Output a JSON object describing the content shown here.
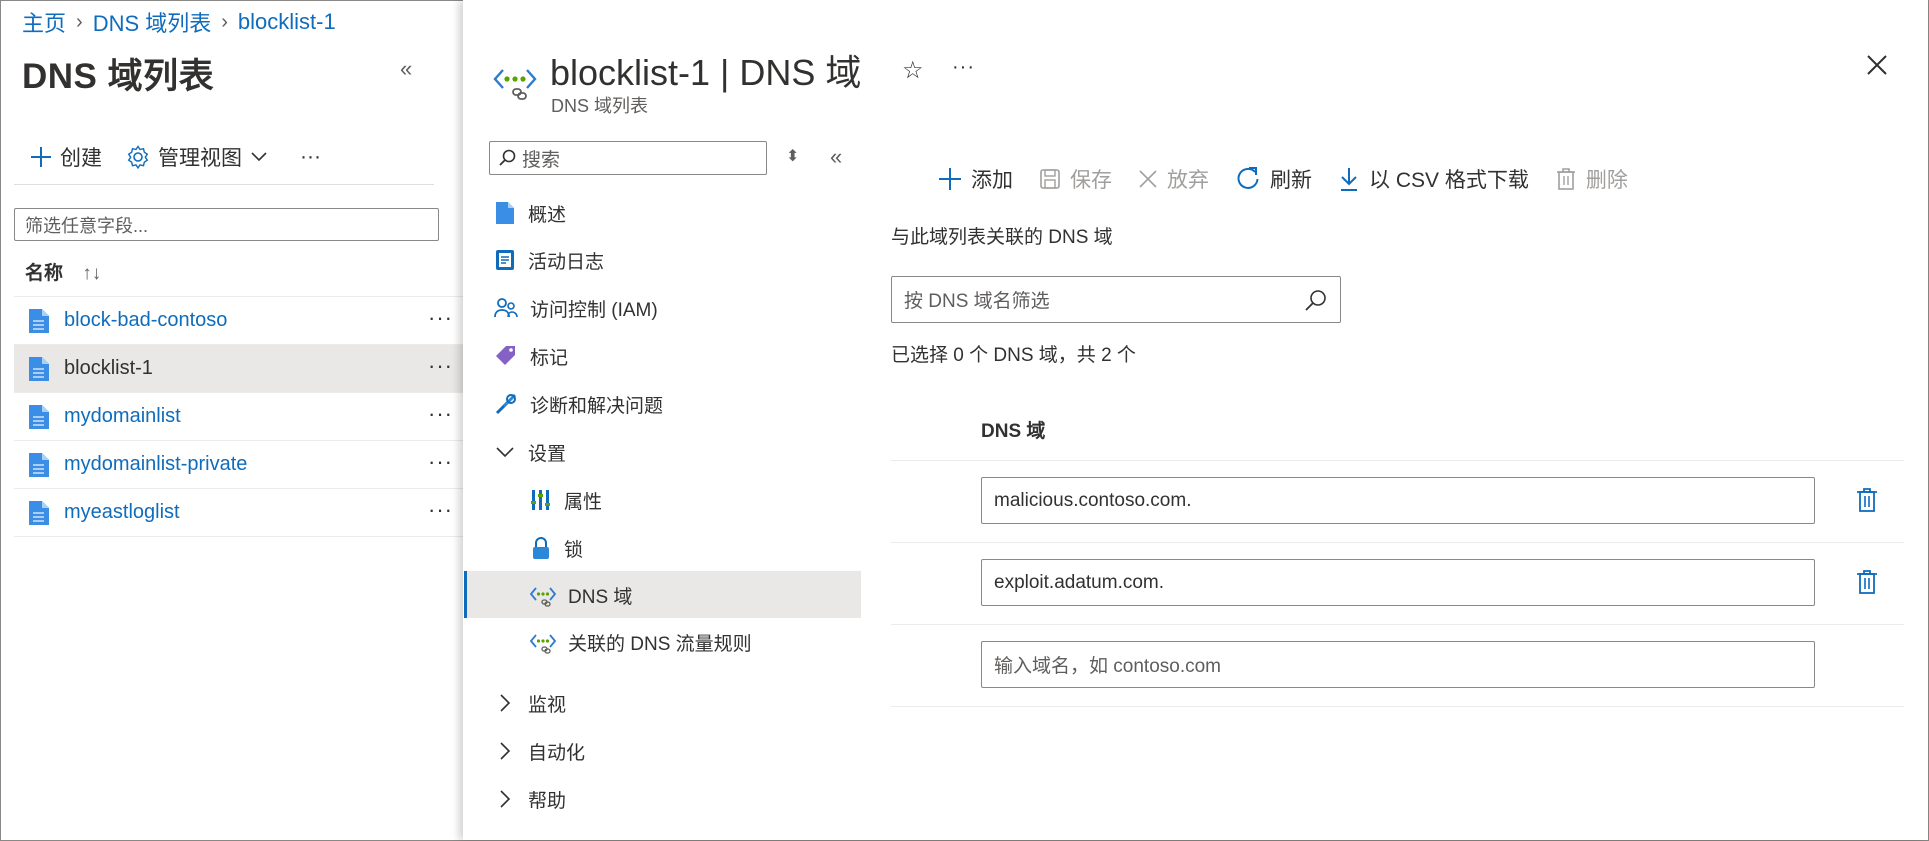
{
  "breadcrumb": [
    "主页",
    "DNS 域列表",
    "blocklist-1"
  ],
  "left": {
    "title": "DNS 域列表",
    "toolbar": {
      "create": "创建",
      "manage_view": "管理视图",
      "more": "···"
    },
    "filter_placeholder": "筛选任意字段...",
    "column_header": "名称",
    "items": [
      {
        "name": "block-bad-contoso",
        "selected": false
      },
      {
        "name": "blocklist-1",
        "selected": true
      },
      {
        "name": "mydomainlist",
        "selected": false
      },
      {
        "name": "mydomainlist-private",
        "selected": false
      },
      {
        "name": "myeastloglist",
        "selected": false
      }
    ]
  },
  "blade": {
    "title": "blocklist-1 | DNS 域",
    "subtitle": "DNS 域列表",
    "search_placeholder": "搜索",
    "nav": {
      "overview": "概述",
      "activity_log": "活动日志",
      "iam": "访问控制 (IAM)",
      "tags": "标记",
      "diagnose": "诊断和解决问题",
      "settings": "设置",
      "properties": "属性",
      "locks": "锁",
      "dns_domains": "DNS 域",
      "linked_rules": "关联的 DNS 流量规则",
      "monitoring": "监视",
      "automation": "自动化",
      "help": "帮助"
    }
  },
  "content": {
    "commands": {
      "add": "添加",
      "save": "保存",
      "discard": "放弃",
      "refresh": "刷新",
      "download": "以 CSV 格式下载",
      "delete": "删除"
    },
    "description": "与此域列表关联的 DNS 域",
    "filter_placeholder": "按 DNS 域名筛选",
    "selection_count": "已选择 0 个 DNS 域，共 2 个",
    "column_header": "DNS 域",
    "domains": [
      "malicious.contoso.com.",
      "exploit.adatum.com."
    ],
    "new_placeholder": "输入域名，如 contoso.com"
  },
  "colors": {
    "link": "#0f6cbd",
    "selected_bg": "#e9e8e7",
    "disabled": "#a19f9d"
  }
}
